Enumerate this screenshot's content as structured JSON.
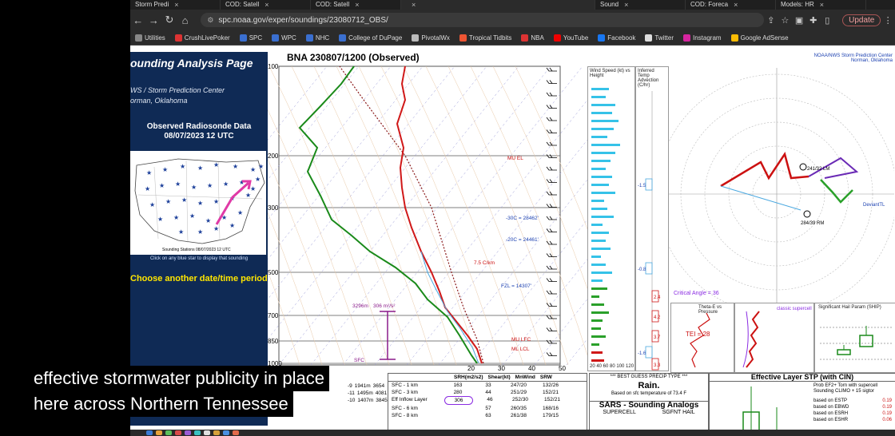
{
  "tabs": [
    {
      "label": "Storm Predi",
      "active": false
    },
    {
      "label": "COD: Satell",
      "active": false
    },
    {
      "label": "COD: Satell",
      "active": false
    },
    {
      "label": "",
      "active": true
    },
    {
      "label": "Sound",
      "active": false
    },
    {
      "label": "COD: Foreca",
      "active": false
    },
    {
      "label": "Models: HR",
      "active": false
    }
  ],
  "address": {
    "url": "spc.noaa.gov/exper/soundings/23080712_OBS/"
  },
  "update_label": "Update",
  "bookmarks": [
    {
      "label": "Utilities",
      "color": "#888888"
    },
    {
      "label": "CrushLivePoker",
      "color": "#d33"
    },
    {
      "label": "SPC",
      "color": "#3a6fd0"
    },
    {
      "label": "WPC",
      "color": "#3a6fd0"
    },
    {
      "label": "NHC",
      "color": "#3a6fd0"
    },
    {
      "label": "College of DuPage",
      "color": "#3a6fd0"
    },
    {
      "label": "PivotalWx",
      "color": "#bbbbbb"
    },
    {
      "label": "Tropical Tidbits",
      "color": "#e53"
    },
    {
      "label": "NBA",
      "color": "#d33"
    },
    {
      "label": "YouTube",
      "color": "#e00"
    },
    {
      "label": "Facebook",
      "color": "#1877f2"
    },
    {
      "label": "Twitter",
      "color": "#dddddd"
    },
    {
      "label": "Instagram",
      "color": "#d6249f"
    },
    {
      "label": "Google AdSense",
      "color": "#fbbc04"
    }
  ],
  "left_panel": {
    "title": "ounding Analysis Page",
    "org_line1": "WS / Storm Prediction Center",
    "org_line2": "orman, Oklahoma",
    "obs_title": "Observed Radiosonde Data",
    "obs_date": "08/07/2023 12 UTC",
    "map_caption": "Sounding Stations 08/07/2023 12 UTC",
    "click_text": "Click on any blue star to display that sounding",
    "choose_text": "Choose another date/time period"
  },
  "skewt": {
    "title": "BNA  230807/1200  (Observed)",
    "pressure_labels": [
      "100",
      "200",
      "300",
      "500",
      "700",
      "850",
      "1000"
    ],
    "temp_labels": [
      "20",
      "30",
      "40",
      "50"
    ],
    "annotations": {
      "mu_el": "MU EL",
      "c30": "-30C = 28462'",
      "c20": "-20C = 24461'",
      "lapse": "7.5 C/km",
      "fzl": "FZL = 14307'",
      "mu_lfc": "MU LFC",
      "ml_lcl": "ML LCL",
      "eff_depth": "3296m",
      "eff_depth_b": "306 m²/s²",
      "sfc": "SFC"
    }
  },
  "wind_panel": {
    "title": "Wind Speed (kt) vs Height",
    "axis": "20 40 60 80 100 120"
  },
  "inferred_panel": {
    "title": "Inferred Temp Advection (C/hr)",
    "values": [
      "-1.5",
      "-0.8",
      "2.4",
      "4.2",
      "3.7",
      "-1.6",
      "3.3"
    ]
  },
  "hodo": {
    "header_line1": "NOAA/NWS Storm Prediction Center",
    "header_line2": "Norman, Oklahoma",
    "critical_angle": "Critical Angle = 36",
    "lm_label": "241/32 LM",
    "rm_label": "284/39 RM",
    "deviant": "DeviantTL"
  },
  "theta_panel": {
    "title": "Theta-E vs Pressure",
    "tei": "TEI = 28"
  },
  "storm_panel": {
    "title": "classic supercell"
  },
  "stp_small_panel": {
    "title": "Significant Hail Param (SHIP)"
  },
  "bottom": {
    "shear_header": [
      "SRH(m2/s2)",
      "Shear(kt)",
      "MnWind",
      "SRW"
    ],
    "shear_rows": [
      {
        "layer": "SFC - 1 km",
        "srh": "163",
        "shear": "33",
        "mnwind": "247/20",
        "srw": "132/26"
      },
      {
        "layer": "SFC - 3 km",
        "srh": "280",
        "shear": "44",
        "mnwind": "251/29",
        "srw": "152/21"
      },
      {
        "layer": "Eff Inflow Layer",
        "srh": "306",
        "shear": "46",
        "mnwind": "252/30",
        "srw": "152/21"
      },
      {
        "layer": "SFC - 6 km",
        "srh": "",
        "shear": "57",
        "mnwind": "260/35",
        "srw": "168/16"
      },
      {
        "layer": "SFC - 8 km",
        "srh": "",
        "shear": "63",
        "mnwind": "261/38",
        "srw": "179/15"
      }
    ],
    "left_col": [
      {
        "a": "-9",
        "b": "1941m",
        "c": "3654"
      },
      {
        "a": "-11",
        "b": "1495m",
        "c": "4081"
      },
      {
        "a": "-10",
        "b": "1407m",
        "c": "3845"
      }
    ],
    "precip_header": "*** BEST GUESS PRECIP TYPE ***",
    "precip_value": "Rain.",
    "precip_note": "Based on sfc temperature of 73.4 F",
    "sars_title": "SARS - Sounding Analogs",
    "sars_cols": [
      "SUPERCELL",
      "SGFNT HAIL"
    ],
    "stp_title": "Effective Layer STP (with CIN)",
    "stp_note1": "Prob EF2+ Torn with supercell",
    "stp_note2": "Sounding CLIMO + 15 sigtor",
    "stp_rows": [
      {
        "label": "based on ESTP",
        "value": "0.19"
      },
      {
        "label": "based on EBWD",
        "value": "0.19"
      },
      {
        "label": "based on ESRH",
        "value": "0.19"
      },
      {
        "label": "based on ESHR",
        "value": "0.06"
      }
    ]
  },
  "subtitles": {
    "line1": "effective stormwater publicity in place",
    "line2": "here across Northern Tennessee"
  },
  "colors": {
    "temp": "#d01818",
    "dewpoint": "#1a8a1a",
    "parcel": "#8b1a1a",
    "page_nav": "#0f2a55",
    "wind_bars": "#35c2e8",
    "hodo_red": "#cc1111",
    "hodo_purple": "#6a2ab5",
    "hodo_green": "#2aa02a"
  }
}
